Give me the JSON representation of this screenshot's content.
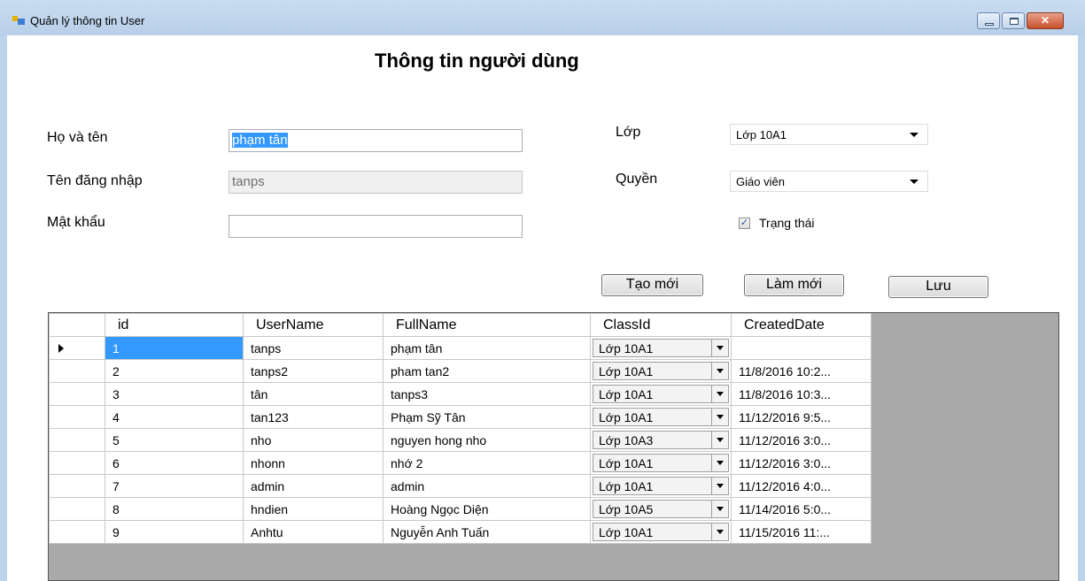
{
  "window": {
    "title": "Quản lý thông tin User"
  },
  "form": {
    "heading": "Thông tin người dùng",
    "fullname_label": "Họ và tên",
    "fullname_value": "phạm tân",
    "username_label": "Tên đăng nhập",
    "username_value": "tanps",
    "password_label": "Mật khẩu",
    "password_value": "",
    "class_label": "Lớp",
    "class_value": "Lớp 10A1",
    "role_label": "Quyền",
    "role_value": "Giáo viên",
    "status_label": "Trạng thái",
    "status_checked": true
  },
  "buttons": {
    "create": "Tạo mới",
    "refresh": "Làm mới",
    "save": "Lưu"
  },
  "grid": {
    "columns": [
      "id",
      "UserName",
      "FullName",
      "ClassId",
      "CreatedDate"
    ],
    "rows": [
      {
        "id": "1",
        "username": "tanps",
        "fullname": "phạm tân",
        "classid": "Lớp 10A1",
        "created": ""
      },
      {
        "id": "2",
        "username": "tanps2",
        "fullname": "pham tan2",
        "classid": "Lớp 10A1",
        "created": "11/8/2016 10:2..."
      },
      {
        "id": "3",
        "username": "tân",
        "fullname": "tanps3",
        "classid": "Lớp 10A1",
        "created": "11/8/2016 10:3..."
      },
      {
        "id": "4",
        "username": "tan123",
        "fullname": "Phạm Sỹ Tân",
        "classid": "Lớp 10A1",
        "created": "11/12/2016 9:5..."
      },
      {
        "id": "5",
        "username": "nho",
        "fullname": "nguyen hong nho",
        "classid": "Lớp 10A3",
        "created": "11/12/2016 3:0..."
      },
      {
        "id": "6",
        "username": "nhonn",
        "fullname": "nhớ 2",
        "classid": "Lớp 10A1",
        "created": "11/12/2016 3:0..."
      },
      {
        "id": "7",
        "username": "admin",
        "fullname": "admin",
        "classid": "Lớp 10A1",
        "created": "11/12/2016 4:0..."
      },
      {
        "id": "8",
        "username": "hndien",
        "fullname": "Hoàng Ngọc Diện",
        "classid": "Lớp 10A5",
        "created": "11/14/2016 5:0..."
      },
      {
        "id": "9",
        "username": "Anhtu",
        "fullname": "Nguyễn Anh Tuấn",
        "classid": "Lớp 10A1",
        "created": "11/15/2016 11:..."
      }
    ]
  },
  "icons": {
    "app": "app-form-icon",
    "minimize": "minimize-icon",
    "maximize": "maximize-icon",
    "close": "close-icon",
    "dropdown": "chevron-down-icon",
    "checkbox": "checkmark-icon",
    "row_pointer": "row-pointer-icon"
  },
  "colors": {
    "titlebar": "#bcd3ec",
    "selection": "#3399ff",
    "close_button": "#c8502c",
    "grid_background": "#a9a9a9"
  }
}
